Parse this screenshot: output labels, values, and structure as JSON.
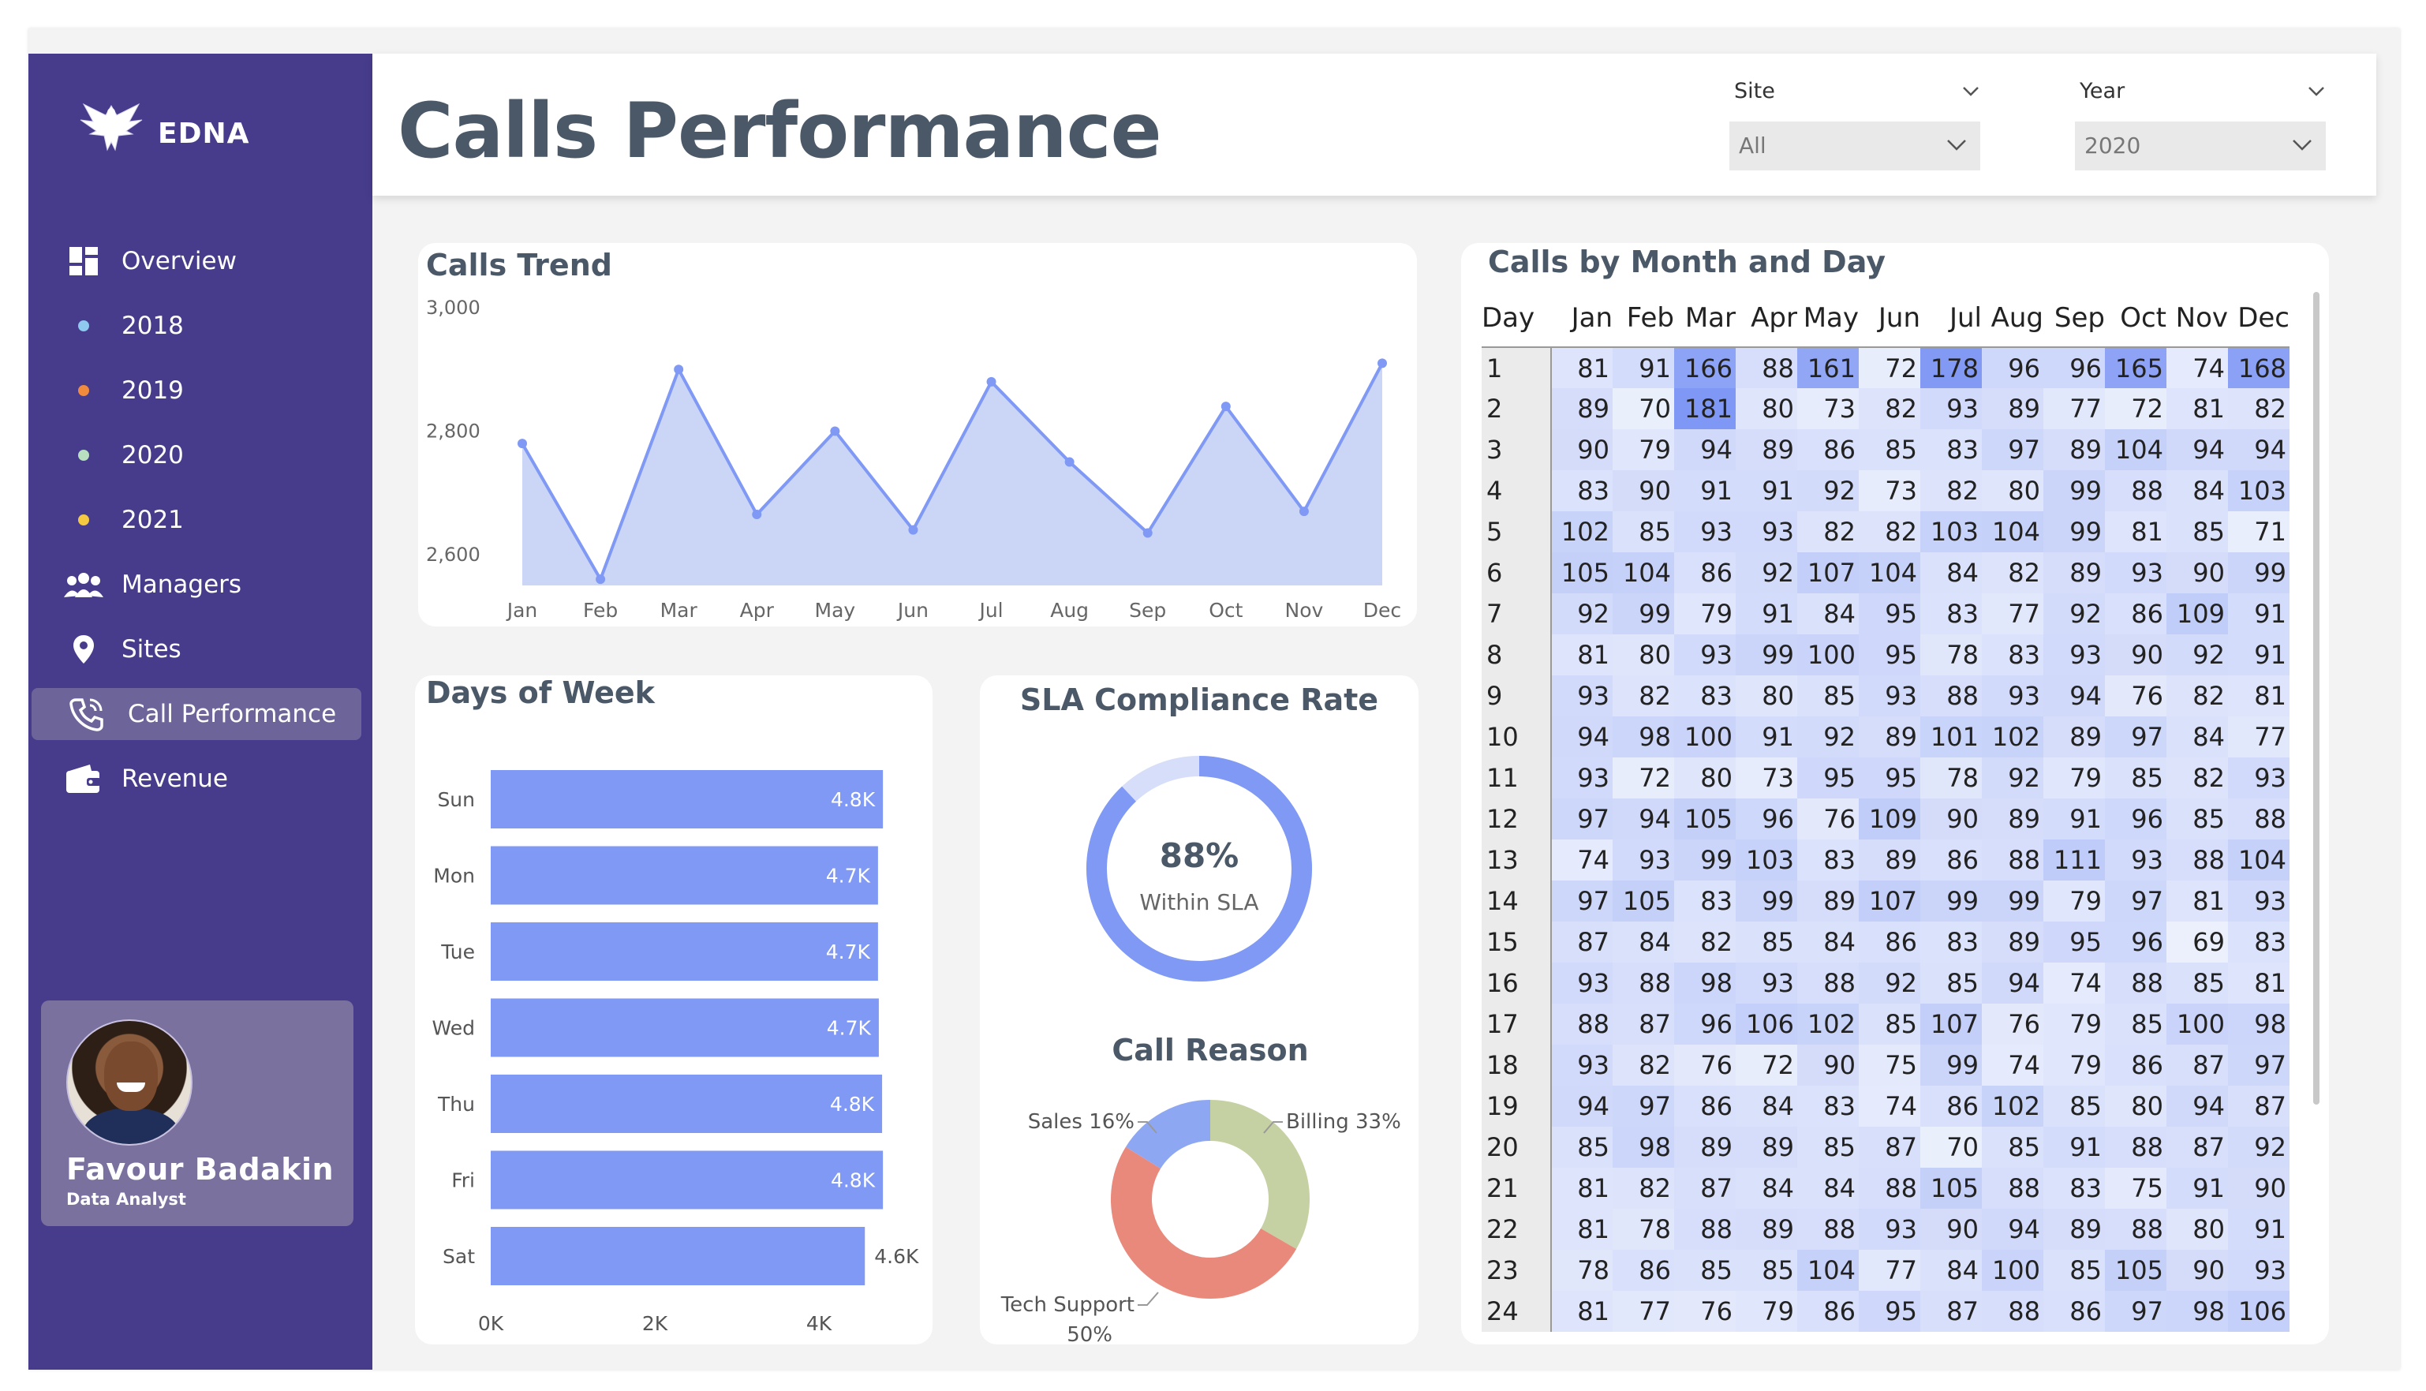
{
  "app": {
    "logo_text": "EDNA"
  },
  "sidebar": {
    "items": [
      {
        "label": "Overview",
        "icon": "dashboard-icon"
      },
      {
        "label": "2018",
        "icon": "dot-icon",
        "color": "#8ec9f0"
      },
      {
        "label": "2019",
        "icon": "dot-icon",
        "color": "#f08a3c"
      },
      {
        "label": "2020",
        "icon": "dot-icon",
        "color": "#b8e0c0"
      },
      {
        "label": "2021",
        "icon": "dot-icon",
        "color": "#f5c842"
      },
      {
        "label": "Managers",
        "icon": "users-icon"
      },
      {
        "label": "Sites",
        "icon": "map-pin-icon"
      },
      {
        "label": "Call Performance",
        "icon": "phone-icon",
        "active": true
      },
      {
        "label": "Revenue",
        "icon": "wallet-icon"
      }
    ],
    "profile": {
      "name": "Favour Badakin",
      "role": "Data Analyst"
    }
  },
  "header": {
    "title": "Calls Performance",
    "filters": [
      {
        "label": "Site",
        "value": "All"
      },
      {
        "label": "Year",
        "value": "2020"
      }
    ]
  },
  "colors": {
    "sidebar_bg": "#473c8c",
    "accent": "#7f99f5",
    "area_fill": "#cbd6f7",
    "title_text": "#4a5868",
    "billing": "#c5d1a2",
    "tech_support": "#e8897c",
    "sales": "#8ea7f3"
  },
  "chart_data": [
    {
      "type": "area",
      "title": "Calls Trend",
      "categories": [
        "Jan",
        "Feb",
        "Mar",
        "Apr",
        "May",
        "Jun",
        "Jul",
        "Aug",
        "Sep",
        "Oct",
        "Nov",
        "Dec"
      ],
      "values": [
        2780,
        2560,
        2900,
        2665,
        2800,
        2640,
        2880,
        2750,
        2635,
        2840,
        2670,
        2910
      ],
      "y_ticks": [
        "3,000",
        "2,800",
        "2,600"
      ],
      "ylim": [
        2550,
        3000
      ]
    },
    {
      "type": "bar",
      "title": "Days of Week",
      "orientation": "horizontal",
      "categories": [
        "Sun",
        "Mon",
        "Tue",
        "Wed",
        "Thu",
        "Fri",
        "Sat"
      ],
      "values": [
        4780,
        4720,
        4720,
        4730,
        4770,
        4780,
        4560
      ],
      "labels": [
        "4.8K",
        "4.7K",
        "4.7K",
        "4.7K",
        "4.8K",
        "4.8K",
        "4.6K"
      ],
      "x_ticks": [
        "0K",
        "2K",
        "4K"
      ],
      "xlim": [
        0,
        5000
      ]
    },
    {
      "type": "pie",
      "title": "SLA Compliance Rate",
      "value": 88,
      "center_value": "88%",
      "center_label": "Within SLA"
    },
    {
      "type": "pie",
      "title": "Call Reason",
      "slices": [
        {
          "name": "Billing",
          "value": 33,
          "label": "Billing 33%"
        },
        {
          "name": "Tech Support",
          "value": 50,
          "label_line1": "Tech Support",
          "label_line2": "50%"
        },
        {
          "name": "Sales",
          "value": 16,
          "label": "Sales 16%"
        }
      ]
    },
    {
      "type": "heatmap",
      "title": "Calls by Month and Day",
      "row_header": "Day",
      "columns": [
        "Jan",
        "Feb",
        "Mar",
        "Apr",
        "May",
        "Jun",
        "Jul",
        "Aug",
        "Sep",
        "Oct",
        "Nov",
        "Dec"
      ],
      "rows": [
        {
          "day": "1",
          "values": [
            81,
            91,
            166,
            88,
            161,
            72,
            178,
            96,
            96,
            165,
            74,
            168
          ]
        },
        {
          "day": "2",
          "values": [
            89,
            70,
            181,
            80,
            73,
            82,
            93,
            89,
            77,
            72,
            81,
            82
          ]
        },
        {
          "day": "3",
          "values": [
            90,
            79,
            94,
            89,
            86,
            85,
            83,
            97,
            89,
            104,
            94,
            94
          ]
        },
        {
          "day": "4",
          "values": [
            83,
            90,
            91,
            91,
            92,
            73,
            82,
            80,
            99,
            88,
            84,
            103
          ]
        },
        {
          "day": "5",
          "values": [
            102,
            85,
            93,
            93,
            82,
            82,
            103,
            104,
            99,
            81,
            85,
            71
          ]
        },
        {
          "day": "6",
          "values": [
            105,
            104,
            86,
            92,
            107,
            104,
            84,
            82,
            89,
            93,
            90,
            99
          ]
        },
        {
          "day": "7",
          "values": [
            92,
            99,
            79,
            91,
            84,
            95,
            83,
            77,
            92,
            86,
            109,
            91
          ]
        },
        {
          "day": "8",
          "values": [
            81,
            80,
            93,
            99,
            100,
            95,
            78,
            83,
            93,
            90,
            92,
            91
          ]
        },
        {
          "day": "9",
          "values": [
            93,
            82,
            83,
            80,
            85,
            93,
            88,
            93,
            94,
            76,
            82,
            81
          ]
        },
        {
          "day": "10",
          "values": [
            94,
            98,
            100,
            91,
            92,
            89,
            101,
            102,
            89,
            97,
            84,
            77
          ]
        },
        {
          "day": "11",
          "values": [
            93,
            72,
            80,
            73,
            95,
            95,
            78,
            92,
            79,
            85,
            82,
            93
          ]
        },
        {
          "day": "12",
          "values": [
            97,
            94,
            105,
            96,
            76,
            109,
            90,
            89,
            91,
            96,
            85,
            88
          ]
        },
        {
          "day": "13",
          "values": [
            74,
            93,
            99,
            103,
            83,
            89,
            86,
            88,
            111,
            93,
            88,
            104
          ]
        },
        {
          "day": "14",
          "values": [
            97,
            105,
            83,
            99,
            89,
            107,
            99,
            99,
            79,
            97,
            81,
            93
          ]
        },
        {
          "day": "15",
          "values": [
            87,
            84,
            82,
            85,
            84,
            86,
            83,
            89,
            95,
            96,
            69,
            83
          ]
        },
        {
          "day": "16",
          "values": [
            93,
            88,
            98,
            93,
            88,
            92,
            85,
            94,
            74,
            88,
            85,
            81
          ]
        },
        {
          "day": "17",
          "values": [
            88,
            87,
            96,
            106,
            102,
            85,
            107,
            76,
            79,
            85,
            100,
            98
          ]
        },
        {
          "day": "18",
          "values": [
            93,
            82,
            76,
            72,
            90,
            75,
            99,
            74,
            79,
            86,
            87,
            97
          ]
        },
        {
          "day": "19",
          "values": [
            94,
            97,
            86,
            84,
            83,
            74,
            86,
            102,
            85,
            80,
            94,
            87
          ]
        },
        {
          "day": "20",
          "values": [
            85,
            98,
            89,
            89,
            85,
            87,
            70,
            85,
            91,
            88,
            87,
            92
          ]
        },
        {
          "day": "21",
          "values": [
            81,
            82,
            87,
            84,
            84,
            88,
            105,
            88,
            83,
            75,
            91,
            90
          ]
        },
        {
          "day": "22",
          "values": [
            81,
            78,
            88,
            89,
            88,
            93,
            90,
            94,
            89,
            88,
            80,
            91
          ]
        },
        {
          "day": "23",
          "values": [
            78,
            86,
            85,
            85,
            104,
            77,
            84,
            100,
            85,
            105,
            90,
            93
          ]
        },
        {
          "day": "24",
          "values": [
            81,
            77,
            76,
            79,
            86,
            95,
            87,
            88,
            86,
            97,
            98,
            106
          ]
        }
      ]
    }
  ]
}
